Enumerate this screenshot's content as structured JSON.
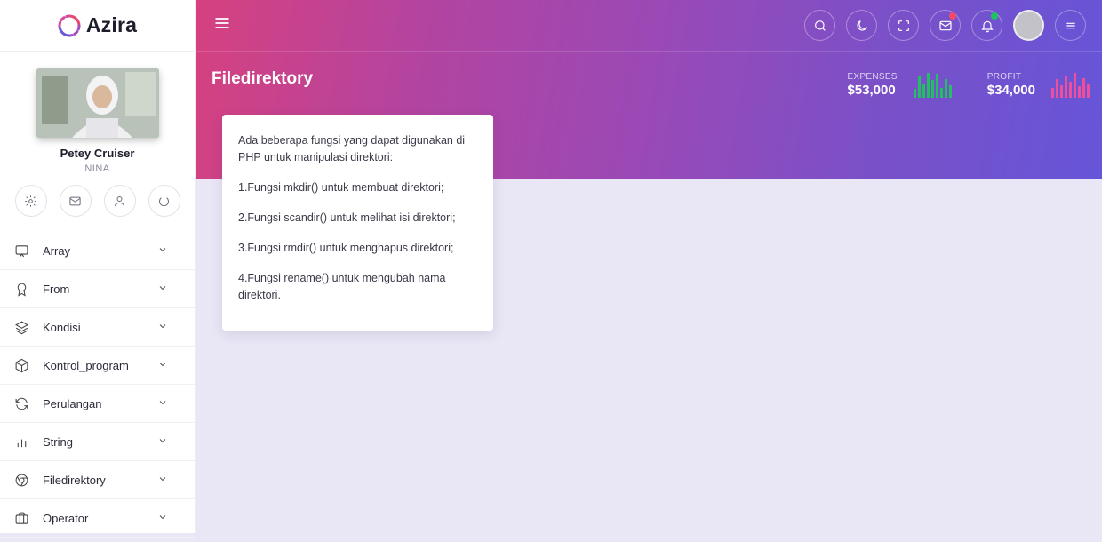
{
  "brand": {
    "name": "Azira",
    "logo_icon": "spinner-logo-icon"
  },
  "profile": {
    "name": "Petey Cruiser",
    "role": "NINA",
    "actions": [
      {
        "name": "settings",
        "icon": "gear-icon"
      },
      {
        "name": "mail",
        "icon": "mail-icon"
      },
      {
        "name": "user",
        "icon": "user-icon"
      },
      {
        "name": "power",
        "icon": "power-icon"
      }
    ]
  },
  "menu": [
    {
      "label": "Array",
      "icon": "monitor-icon"
    },
    {
      "label": "From",
      "icon": "award-icon"
    },
    {
      "label": "Kondisi",
      "icon": "layers-icon"
    },
    {
      "label": "Kontrol_program",
      "icon": "box-icon"
    },
    {
      "label": "Perulangan",
      "icon": "refresh-icon"
    },
    {
      "label": "String",
      "icon": "bar-chart-icon"
    },
    {
      "label": "Filedirektory",
      "icon": "chrome-icon"
    },
    {
      "label": "Operator",
      "icon": "briefcase-icon"
    }
  ],
  "header": {
    "page_title": "Filedirektory",
    "icons": [
      "search-icon",
      "moon-icon",
      "fullscreen-icon",
      "mail-icon",
      "bell-icon",
      "user-avatar",
      "menu-icon"
    ],
    "mail_badge_color": "#f24a6a",
    "bell_badge_color": "#22c063"
  },
  "stats": [
    {
      "label": "EXPENSES",
      "value": "$53,000",
      "color": "#22c063",
      "bars": [
        0.35,
        0.85,
        0.55,
        1.0,
        0.7,
        0.95,
        0.4,
        0.75,
        0.5
      ]
    },
    {
      "label": "PROFIT",
      "value": "$34,000",
      "color": "#ee4f9a",
      "bars": [
        0.4,
        0.75,
        0.5,
        0.9,
        0.65,
        1.0,
        0.45,
        0.8,
        0.55
      ]
    }
  ],
  "content": {
    "intro": "Ada beberapa fungsi yang dapat digunakan di PHP untuk manipulasi direktori:",
    "items": [
      "1.Fungsi mkdir() untuk membuat direktori;",
      "2.Fungsi scandir() untuk melihat isi direktori;",
      "3.Fungsi rmdir() untuk menghapus direktori;",
      "4.Fungsi rename() untuk mengubah nama direktori."
    ]
  }
}
